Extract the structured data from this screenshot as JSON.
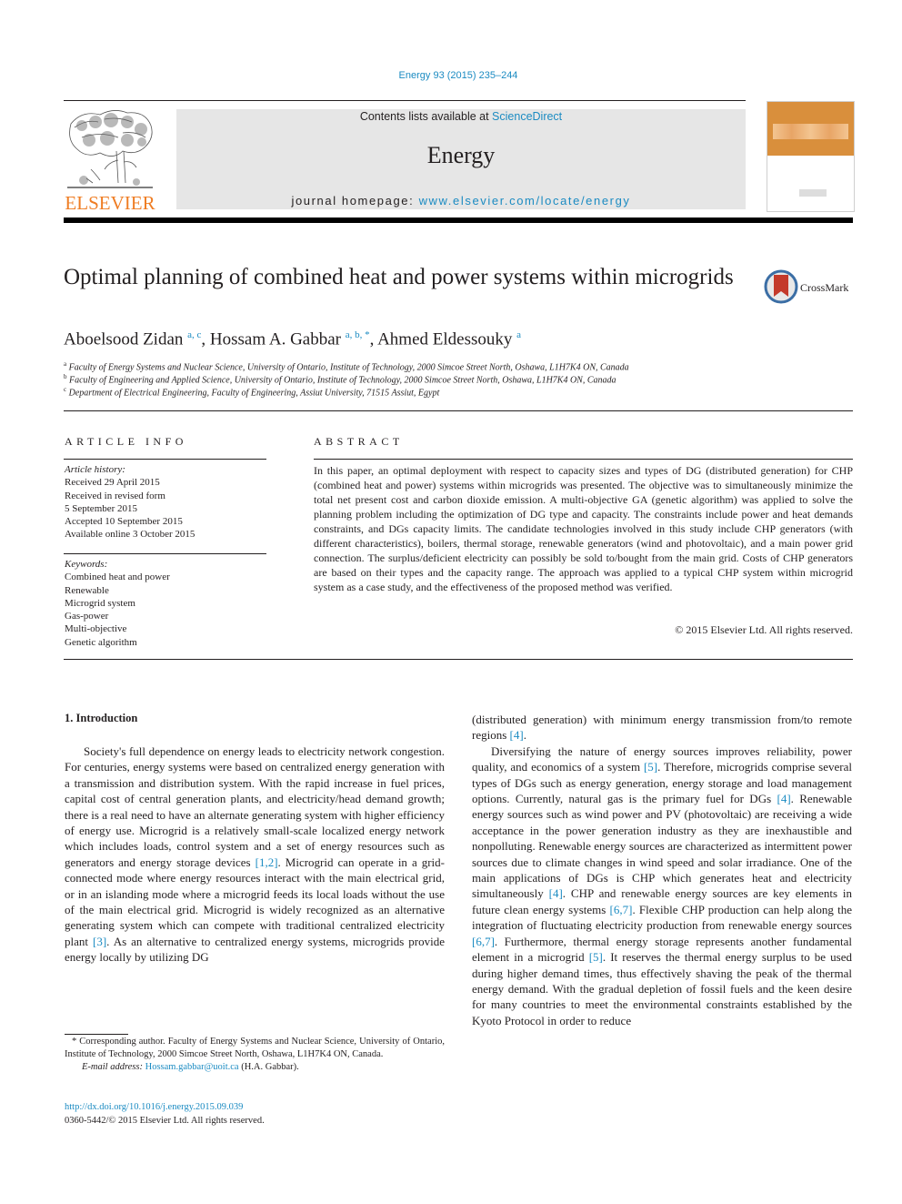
{
  "header": {
    "journal_ref": "Energy 93 (2015) 235–244",
    "contents_prefix": "Contents lists available at ",
    "contents_link": "ScienceDirect",
    "journal_name": "Energy",
    "homepage_prefix": "journal homepage: ",
    "homepage_link": "www.elsevier.com/locate/energy",
    "publisher_logo_text": "ELSEVIER",
    "cover_title": "ENERGY"
  },
  "colors": {
    "link": "#1b8bc2",
    "elsevier_orange": "#ef7d24",
    "masthead_bg": "#e6e6e6",
    "cover_orange": "#d98f3c"
  },
  "article": {
    "title": "Optimal planning of combined heat and power systems within microgrids",
    "crossmark_label": "CrossMark",
    "authors": [
      {
        "name": "Aboelsood Zidan",
        "sup": "a, c",
        "sep": ", "
      },
      {
        "name": "Hossam A. Gabbar",
        "sup": "a, b, *",
        "sep": ", "
      },
      {
        "name": "Ahmed Eldessouky",
        "sup": "a",
        "sep": ""
      }
    ],
    "affiliations": [
      {
        "key": "a",
        "text": "Faculty of Energy Systems and Nuclear Science, University of Ontario, Institute of Technology, 2000 Simcoe Street North, Oshawa, L1H7K4 ON, Canada"
      },
      {
        "key": "b",
        "text": "Faculty of Engineering and Applied Science, University of Ontario, Institute of Technology, 2000 Simcoe Street North, Oshawa, L1H7K4 ON, Canada"
      },
      {
        "key": "c",
        "text": "Department of Electrical Engineering, Faculty of Engineering, Assiut University, 71515 Assiut, Egypt"
      }
    ]
  },
  "article_info": {
    "heading": "ARTICLE INFO",
    "history_label": "Article history:",
    "history": [
      "Received 29 April 2015",
      "Received in revised form",
      "5 September 2015",
      "Accepted 10 September 2015",
      "Available online 3 October 2015"
    ],
    "keywords_label": "Keywords:",
    "keywords": [
      "Combined heat and power",
      "Renewable",
      "Microgrid system",
      "Gas-power",
      "Multi-objective",
      "Genetic algorithm"
    ]
  },
  "abstract": {
    "heading": "ABSTRACT",
    "text": "In this paper, an optimal deployment with respect to capacity sizes and types of DG (distributed generation) for CHP (combined heat and power) systems within microgrids was presented. The objective was to simultaneously minimize the total net present cost and carbon dioxide emission. A multi-objective GA (genetic algorithm) was applied to solve the planning problem including the optimization of DG type and capacity. The constraints include power and heat demands constraints, and DGs capacity limits. The candidate technologies involved in this study include CHP generators (with different characteristics), boilers, thermal storage, renewable generators (wind and photovoltaic), and a main power grid connection. The surplus/deficient electricity can possibly be sold to/bought from the main grid. Costs of CHP generators are based on their types and the capacity range. The approach was applied to a typical CHP system within microgrid system as a case study, and the effectiveness of the proposed method was verified.",
    "copyright": "© 2015 Elsevier Ltd. All rights reserved."
  },
  "body": {
    "section_heading": "1.  Introduction",
    "left_paragraph": [
      {
        "t": "Society's full dependence on energy leads to electricity network congestion. For centuries, energy systems were based on centralized energy generation with a transmission and distribution system. With the rapid increase in fuel prices, capital cost of central generation plants, and electricity/head demand growth; there is a real need to have an alternate generating system with higher efficiency of energy use. Microgrid is a relatively small-scale localized energy network which includes loads, control system and a set of energy resources such as generators and energy storage devices "
      },
      {
        "ref": "[1,2]"
      },
      {
        "t": ". Microgrid can operate in a grid-connected mode where energy resources interact with the main electrical grid, or in an islanding mode where a microgrid feeds its local loads without the use of the main electrical grid. Microgrid is widely recognized as an alternative generating system which can compete with traditional centralized electricity plant "
      },
      {
        "ref": "[3]"
      },
      {
        "t": ". As an alternative to centralized energy systems, microgrids provide energy locally by utilizing DG"
      }
    ],
    "right_continuation": [
      {
        "t": "(distributed generation) with minimum energy transmission from/to remote regions "
      },
      {
        "ref": "[4]"
      },
      {
        "t": "."
      }
    ],
    "right_paragraph": [
      {
        "t": "Diversifying the nature of energy sources improves reliability, power quality, and economics of a system "
      },
      {
        "ref": "[5]"
      },
      {
        "t": ". Therefore, microgrids comprise several types of DGs such as energy generation, energy storage and load management options. Currently, natural gas is the primary fuel for DGs "
      },
      {
        "ref": "[4]"
      },
      {
        "t": ". Renewable energy sources such as wind power and PV (photovoltaic) are receiving a wide acceptance in the power generation industry as they are inexhaustible and nonpolluting. Renewable energy sources are characterized as intermittent power sources due to climate changes in wind speed and solar irradiance. One of the main applications of DGs is CHP which generates heat and electricity simultaneously "
      },
      {
        "ref": "[4]"
      },
      {
        "t": ". CHP and renewable energy sources are key elements in future clean energy systems "
      },
      {
        "ref": "[6,7]"
      },
      {
        "t": ". Flexible CHP production can help along the integration of fluctuating electricity production from renewable energy sources "
      },
      {
        "ref": "[6,7]"
      },
      {
        "t": ". Furthermore, thermal energy storage represents another fundamental element in a microgrid "
      },
      {
        "ref": "[5]"
      },
      {
        "t": ". It reserves the thermal energy surplus to be used during higher demand times, thus effectively shaving the peak of the thermal energy demand. With the gradual depletion of fossil fuels and the keen desire for many countries to meet the environmental constraints established by the Kyoto Protocol in order to reduce"
      }
    ]
  },
  "footnote": {
    "corresponding": "* Corresponding author. Faculty of Energy Systems and Nuclear Science, University of Ontario, Institute of Technology, 2000 Simcoe Street North, Oshawa, L1H7K4 ON, Canada.",
    "email_label": "E-mail address: ",
    "email": "Hossam.gabbar@uoit.ca",
    "email_suffix": " (H.A. Gabbar).",
    "doi": "http://dx.doi.org/10.1016/j.energy.2015.09.039",
    "issn": "0360-5442/© 2015 Elsevier Ltd. All rights reserved."
  }
}
